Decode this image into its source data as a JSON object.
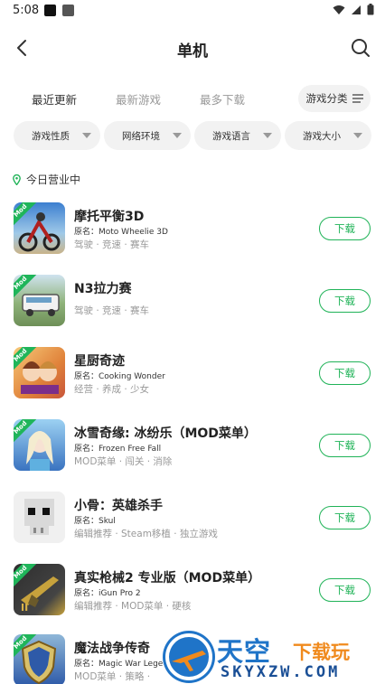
{
  "status_bar": {
    "time": "5:08"
  },
  "header": {
    "title": "单机"
  },
  "tabs": [
    {
      "label": "最近更新",
      "active": true
    },
    {
      "label": "最新游戏",
      "active": false
    },
    {
      "label": "最多下载",
      "active": false
    }
  ],
  "category_button": {
    "label": "游戏分类"
  },
  "filters": [
    {
      "label": "游戏性质"
    },
    {
      "label": "网络环境"
    },
    {
      "label": "游戏语言"
    },
    {
      "label": "游戏大小"
    }
  ],
  "section": {
    "title": "今日营业中"
  },
  "games": [
    {
      "name": "摩托平衡3D",
      "original": "原名：Moto Wheelie 3D",
      "tags": "驾驶 · 竞速 · 赛车",
      "mod": true,
      "icon": "motorcycle-game-icon",
      "colors": [
        "#3c7fd0",
        "#9fc9e8"
      ]
    },
    {
      "name": "N3拉力赛",
      "original": "",
      "tags": "驾驶 · 竞速 · 赛车",
      "mod": true,
      "icon": "rally-bus-game-icon",
      "colors": [
        "#8fb37a",
        "#d7e2c5"
      ]
    },
    {
      "name": "星厨奇迹",
      "original": "原名：Cooking Wonder",
      "tags": "经营 · 养成 · 少女",
      "mod": true,
      "icon": "cooking-girls-game-icon",
      "colors": [
        "#e0823a",
        "#f7c979"
      ]
    },
    {
      "name": "冰雪奇缘: 冰纷乐（MOD菜单）",
      "original": "原名：Frozen Free Fall",
      "tags": "MOD菜单 · 闯关 · 消除",
      "mod": true,
      "icon": "frozen-elsa-game-icon",
      "colors": [
        "#3a73c0",
        "#9cd1f2"
      ]
    },
    {
      "name": "小骨：英雄杀手",
      "original": "原名：Skul",
      "tags": "编辑推荐 · Steam移植 · 独立游戏",
      "mod": false,
      "icon": "skull-pixel-game-icon",
      "colors": [
        "#e7e7e7",
        "#bdbdbd"
      ]
    },
    {
      "name": "真实枪械2 专业版（MOD菜单）",
      "original": "原名：iGun Pro 2",
      "tags": "编辑推荐 · MOD菜单 · 硬核",
      "mod": true,
      "icon": "gun-game-icon",
      "colors": [
        "#2e2e2e",
        "#c7a23c"
      ]
    },
    {
      "name": "魔法战争传奇",
      "original": "原名：Magic War Lege",
      "tags": "MOD菜单 · 策略 · ",
      "mod": true,
      "icon": "magic-war-shield-game-icon",
      "colors": [
        "#2e5aa8",
        "#d8c06a"
      ]
    }
  ],
  "download_label": "下载",
  "watermark": {
    "title_main": "天空",
    "title_accent": "下载玩",
    "domain": "SKYXZW.COM"
  }
}
